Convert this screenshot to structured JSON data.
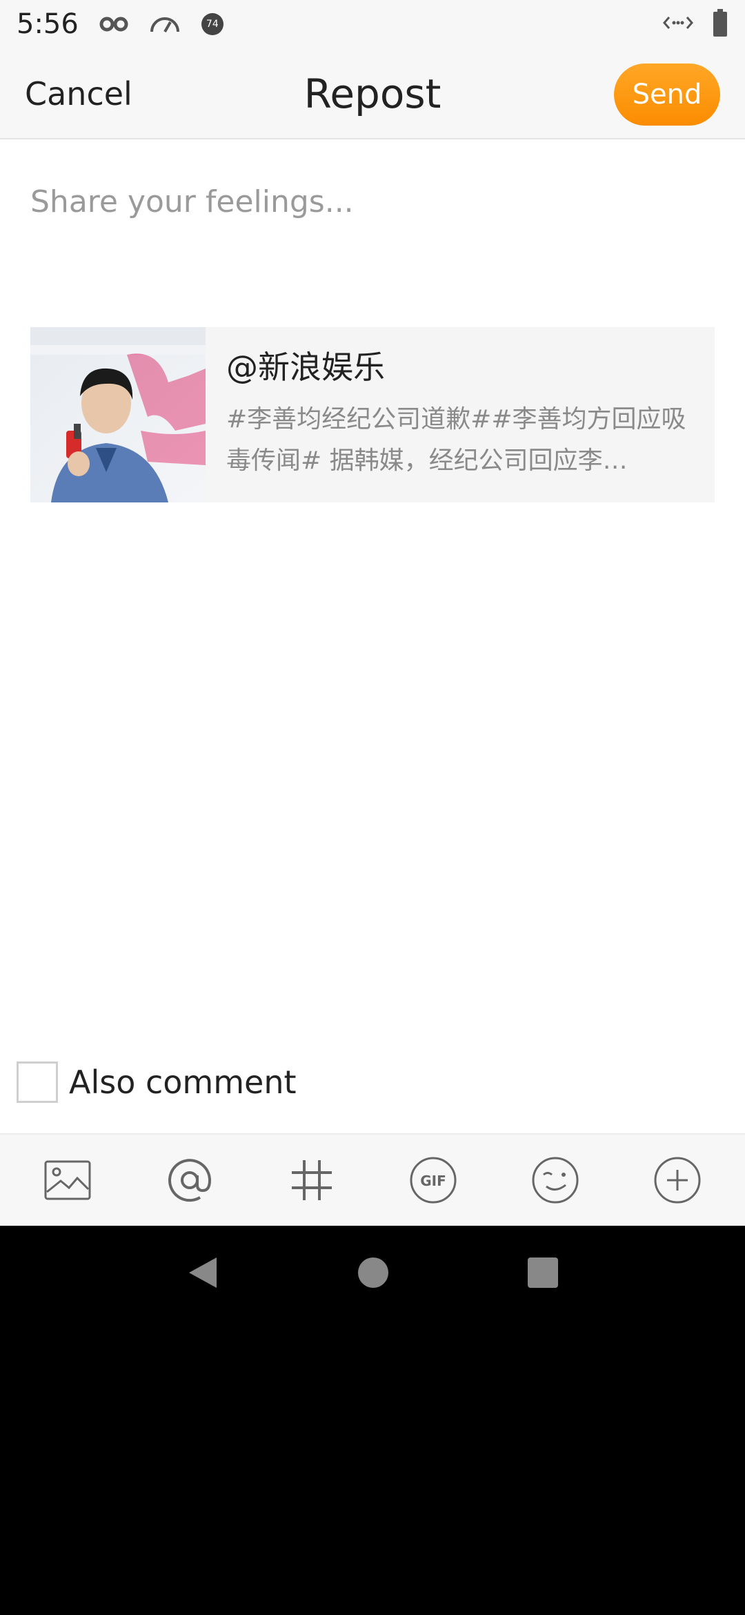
{
  "status_bar": {
    "time": "5:56",
    "ring_badge": "74"
  },
  "header": {
    "cancel_label": "Cancel",
    "title": "Repost",
    "send_label": "Send"
  },
  "compose": {
    "placeholder": "Share your feelings...",
    "value": ""
  },
  "quoted_post": {
    "author": "@新浪娱乐",
    "excerpt": "#李善均经纪公司道歉##李善均方回应吸毒传闻# 据韩媒，经纪公司回应李…"
  },
  "also_comment": {
    "label": "Also comment",
    "checked": false
  },
  "toolbar": {
    "items": [
      "image-icon",
      "mention-icon",
      "hashtag-icon",
      "gif-icon",
      "emoji-icon",
      "add-icon"
    ]
  },
  "colors": {
    "accent": "#fb8c00",
    "background": "#f7f7f7"
  }
}
